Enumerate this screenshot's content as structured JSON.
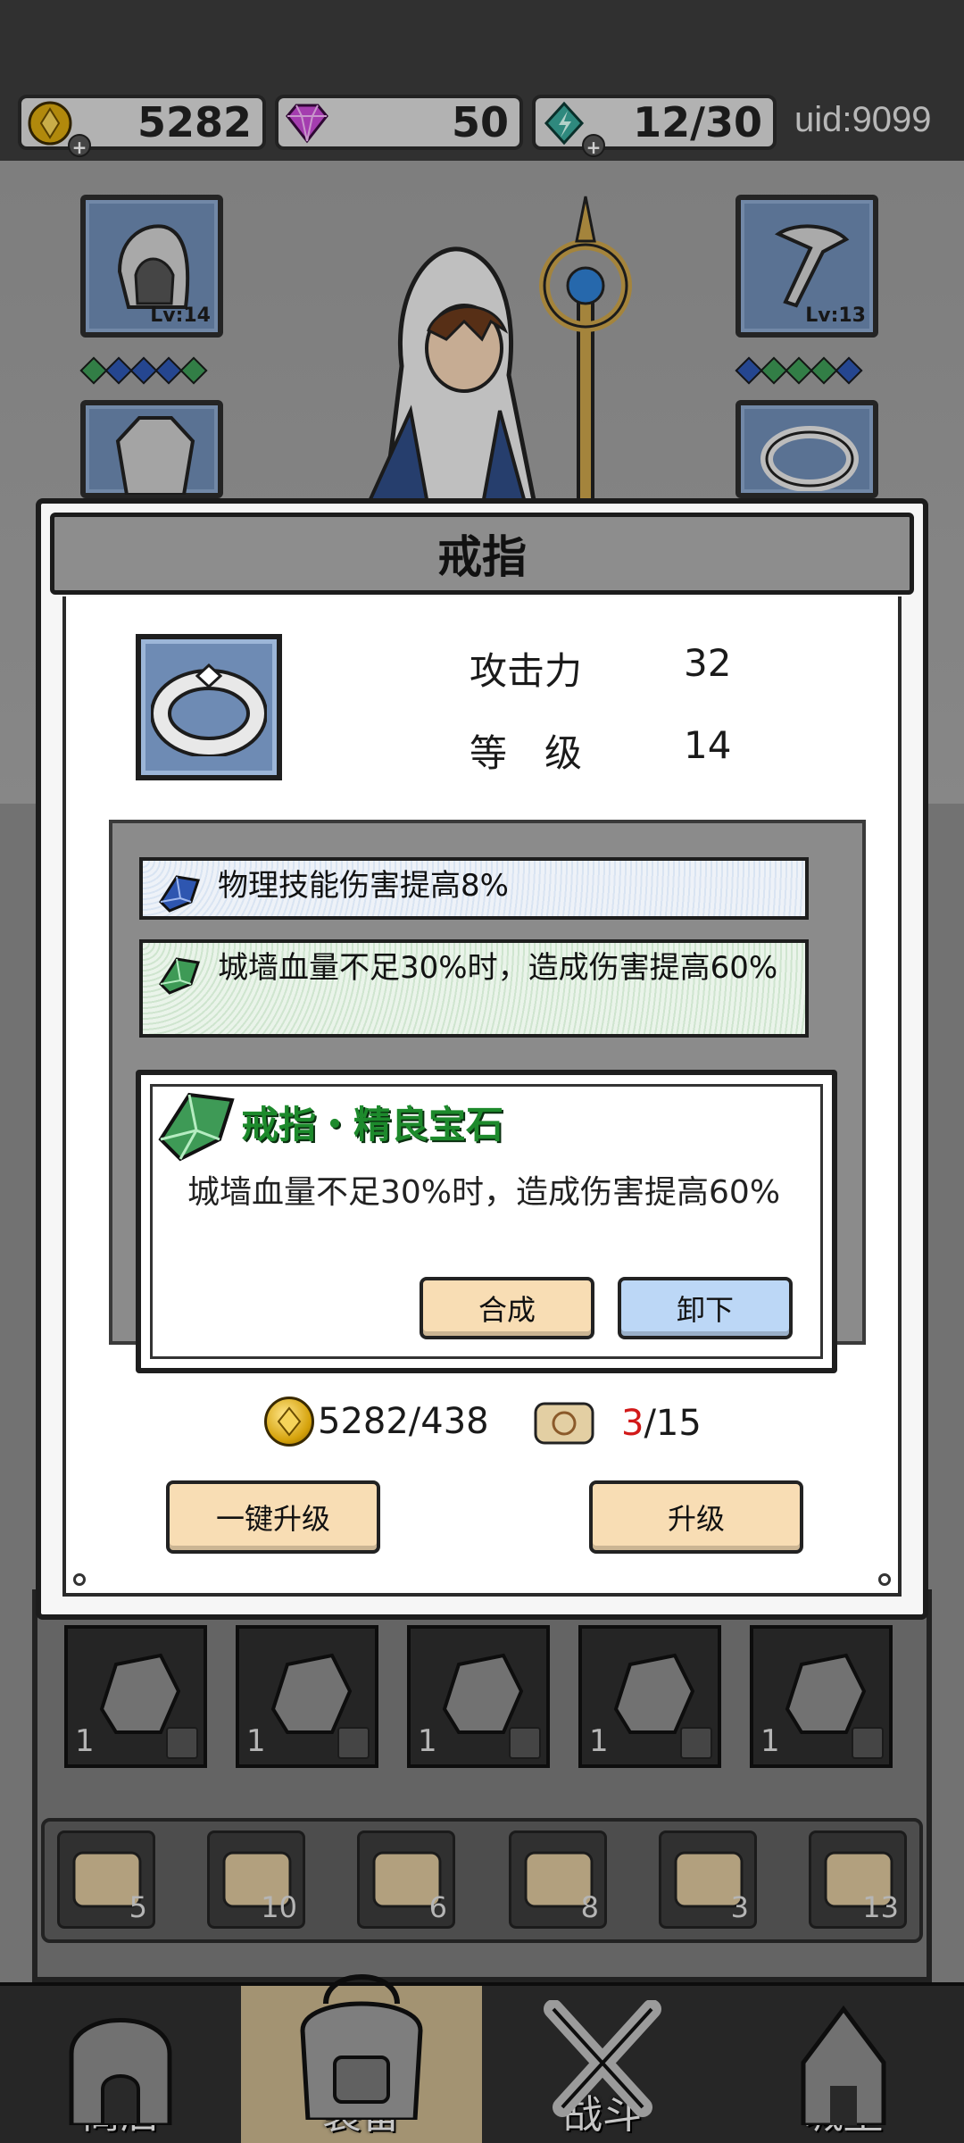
{
  "top_bar": {
    "gold": "5282",
    "diamonds": "50",
    "energy": "12/30",
    "uid": "uid:9099",
    "plus_symbol": "+"
  },
  "equipment_slots": {
    "helmet_level": "Lv:14",
    "weapon_level": "Lv:13"
  },
  "modal": {
    "title": "戒指",
    "stats": [
      {
        "label": "攻击力",
        "value": "32"
      },
      {
        "label": "等　级",
        "value": "14"
      }
    ],
    "effects": [
      {
        "gem": "blue",
        "text": "物理技能伤害提高8%"
      },
      {
        "gem": "green",
        "text": "城墙血量不足30%时，造成伤害提高60%"
      }
    ],
    "gem_popup": {
      "title": "戒指・精良宝石",
      "description": "城墙血量不足30%时，造成伤害提高60%",
      "combine_label": "合成",
      "unequip_label": "卸下"
    },
    "cost": {
      "gold": "5282/438",
      "scroll_have": "3",
      "scroll_need": "/15"
    },
    "one_key_upgrade_label": "一键升级",
    "upgrade_label": "升级"
  },
  "inventory": {
    "stones": [
      {
        "count": "1"
      },
      {
        "count": "1"
      },
      {
        "count": "1"
      },
      {
        "count": "1"
      },
      {
        "count": "1"
      }
    ],
    "scrolls": [
      {
        "count": "5"
      },
      {
        "count": "10"
      },
      {
        "count": "6"
      },
      {
        "count": "8"
      },
      {
        "count": "3"
      },
      {
        "count": "13"
      }
    ]
  },
  "bottom_nav": {
    "items": [
      {
        "label": "商店",
        "icon": "shop-icon"
      },
      {
        "label": "装备",
        "icon": "backpack-icon"
      },
      {
        "label": "战斗",
        "icon": "crossed-swords-icon"
      },
      {
        "label": "城堡",
        "icon": "castle-icon"
      }
    ],
    "active_index": 1
  },
  "colors": {
    "slot_blue": "#6e8bb4",
    "gem_green_title": "#1d8a2c",
    "scroll_have_red": "#d21919",
    "button_cream": "#f8ddb4",
    "button_blue": "#bcd7f6"
  }
}
